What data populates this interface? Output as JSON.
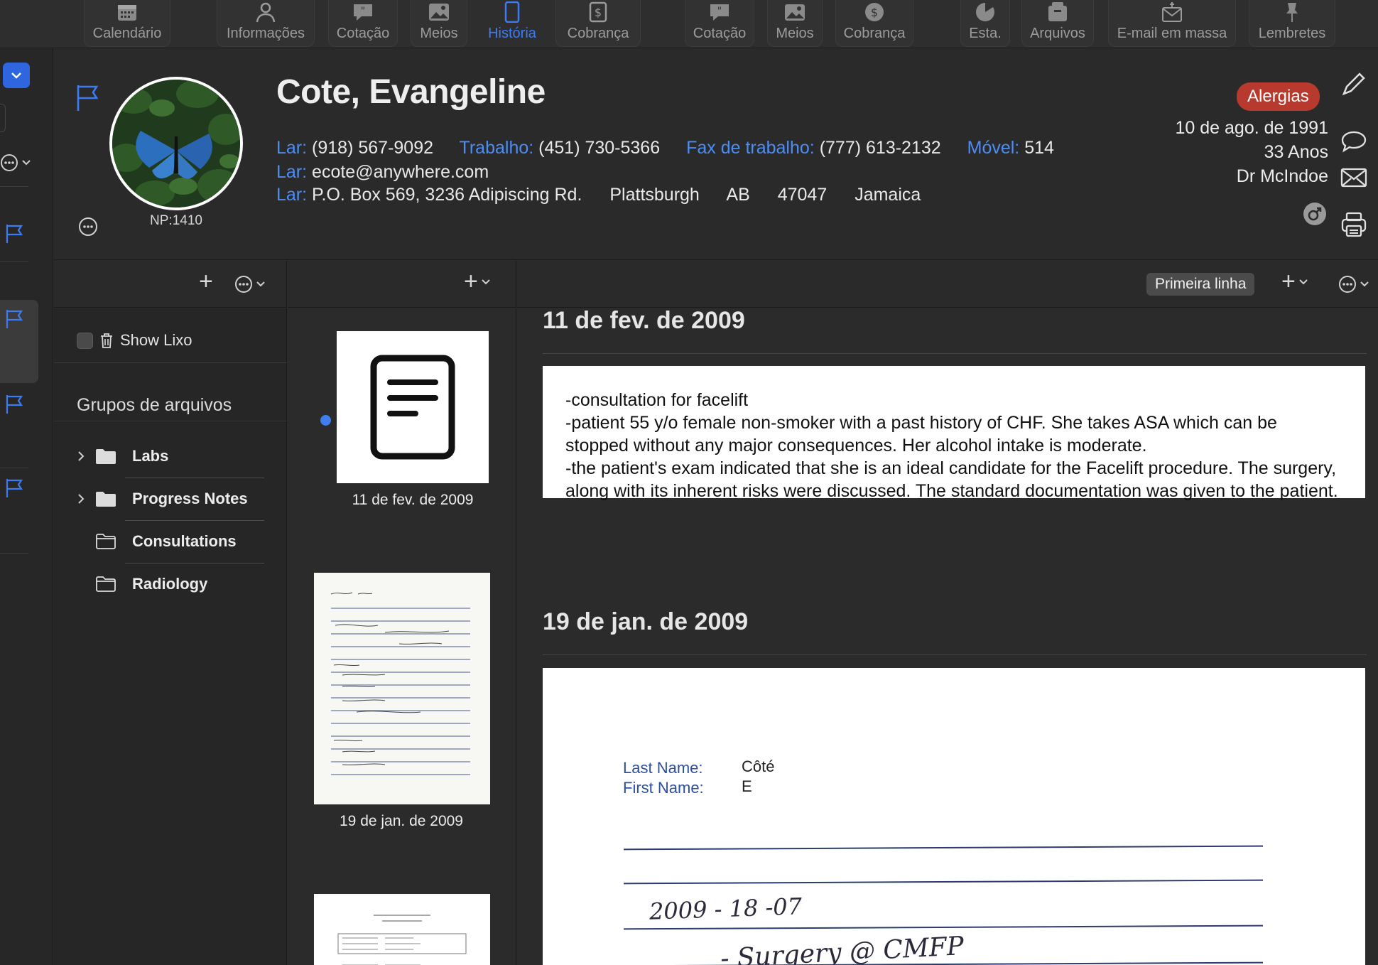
{
  "toolbar": {
    "items": [
      {
        "label": "Calendário",
        "icon": "calendar-icon"
      },
      {
        "label": "Informações",
        "icon": "person-icon"
      },
      {
        "label": "Cotação",
        "icon": "quote-bubble-icon"
      },
      {
        "label": "Meios",
        "icon": "photo-icon"
      },
      {
        "label": "História",
        "icon": "tablet-icon",
        "active": true
      },
      {
        "label": "Cobrança",
        "icon": "dollar-doc-icon"
      },
      {
        "label": "Cotação",
        "icon": "quote-bubble-icon"
      },
      {
        "label": "Meios",
        "icon": "photos-icon"
      },
      {
        "label": "Cobrança",
        "icon": "dollar-circle-icon"
      },
      {
        "label": "Esta.",
        "icon": "pie-chart-icon"
      },
      {
        "label": "Arquivos",
        "icon": "archive-box-icon"
      },
      {
        "label": "E-mail em massa",
        "icon": "bulk-mail-icon"
      },
      {
        "label": "Lembretes",
        "icon": "pin-icon"
      }
    ]
  },
  "patient": {
    "name": "Cote, Evangeline",
    "np": "NP:1410",
    "allergy_badge": "Alergias",
    "dob": "10 de ago. de 1991",
    "age": "33 Anos",
    "doctor": "Dr McIndoe",
    "phones": [
      {
        "label": "Lar:",
        "value": "(918) 567-9092"
      },
      {
        "label": "Trabalho:",
        "value": "(451) 730-5366"
      },
      {
        "label": "Fax de trabalho:",
        "value": "(777) 613-2132"
      },
      {
        "label": "Móvel:",
        "value": "514"
      }
    ],
    "email": {
      "label": "Lar:",
      "value": "ecote@anywhere.com"
    },
    "address": {
      "label": "Lar:",
      "street": "P.O. Box 569, 3236 Adipiscing Rd.",
      "city": "Plattsburgh",
      "region": "AB",
      "postal": "47047",
      "country": "Jamaica"
    }
  },
  "groups_pane": {
    "show_trash_label": "Show Lixo",
    "title": "Grupos de arquivos",
    "items": [
      {
        "label": "Labs",
        "expandable": true
      },
      {
        "label": "Progress Notes",
        "expandable": true
      },
      {
        "label": "Consultations",
        "expandable": false
      },
      {
        "label": "Radiology",
        "expandable": false
      }
    ]
  },
  "thumbnails": [
    {
      "date": "11 de fev. de 2009",
      "kind": "note"
    },
    {
      "date": "19 de jan. de 2009",
      "kind": "scan"
    },
    {
      "date": "",
      "kind": "form"
    }
  ],
  "content": {
    "first_line_button": "Primeira linha",
    "entries": [
      {
        "date": "11 de fev. de 2009",
        "lines": [
          "-consultation for facelift",
          "-patient 55 y/o female non-smoker with a past history of CHF. She takes ASA which can be stopped without any major consequences. Her alcohol intake is moderate.",
          "-the patient's exam indicated that she is an ideal candidate for the Facelift procedure. The surgery, along with its inherent risks were discussed. The standard documentation was given to the patient."
        ]
      },
      {
        "date": "19 de jan. de 2009",
        "scan": {
          "last_name_label": "Last Name:",
          "last_name": "Côté",
          "first_name_label": "First Name:",
          "first_name": "E",
          "handwriting_date": "2009 - 18 -07",
          "handwriting_line": "- Surgery @ CMFP"
        }
      }
    ]
  },
  "colors": {
    "accent_blue": "#3d7bf5",
    "allergy_red": "#b83a2e",
    "label_blue": "#4c8df5"
  }
}
